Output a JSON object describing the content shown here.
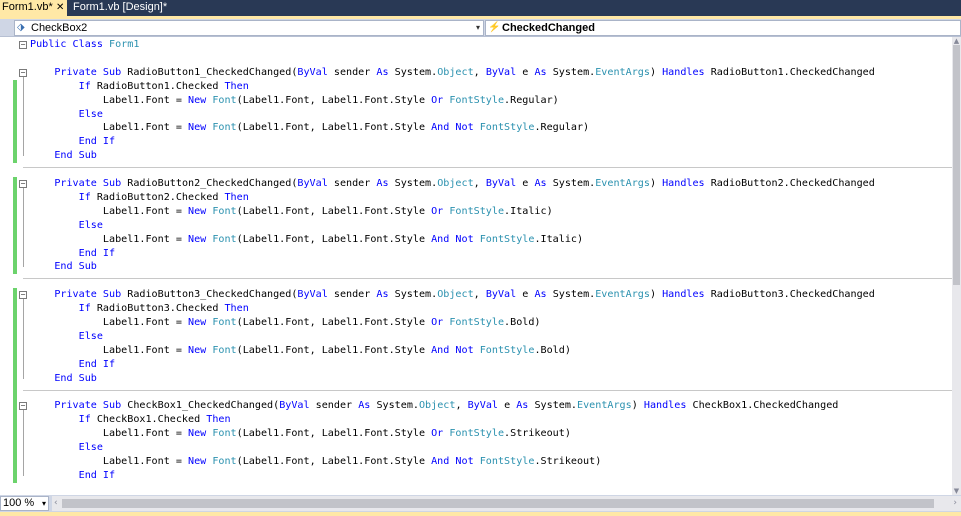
{
  "tabs": [
    {
      "label": "Form1.vb*",
      "close": "✕",
      "active": true
    },
    {
      "label": "Form1.vb [Design]*",
      "active": false
    }
  ],
  "navbar": {
    "object_combo": "CheckBox2",
    "event_combo": "CheckedChanged",
    "object_icon": "control-icon",
    "event_icon": "lightning-icon",
    "arrow": "▾"
  },
  "code_lines": [
    [
      [
        "kw",
        "Public Class "
      ],
      [
        "ty",
        "Form1"
      ]
    ],
    [],
    [
      [
        "",
        "    "
      ],
      [
        "kw",
        "Private Sub "
      ],
      [
        "",
        "RadioButton1_CheckedChanged("
      ],
      [
        "kw",
        "ByVal "
      ],
      [
        "",
        "sender "
      ],
      [
        "kw",
        "As "
      ],
      [
        "",
        "System."
      ],
      [
        "ty",
        "Object"
      ],
      [
        "",
        ", "
      ],
      [
        "kw",
        "ByVal "
      ],
      [
        "",
        "e "
      ],
      [
        "kw",
        "As "
      ],
      [
        "",
        "System."
      ],
      [
        "ty",
        "EventArgs"
      ],
      [
        "",
        ") "
      ],
      [
        "kw",
        "Handles "
      ],
      [
        "",
        "RadioButton1.CheckedChanged"
      ]
    ],
    [
      [
        "",
        "        "
      ],
      [
        "kw",
        "If "
      ],
      [
        "",
        "RadioButton1.Checked "
      ],
      [
        "kw",
        "Then"
      ]
    ],
    [
      [
        "",
        "            Label1.Font = "
      ],
      [
        "kw",
        "New "
      ],
      [
        "ty",
        "Font"
      ],
      [
        "",
        "(Label1.Font, Label1.Font.Style "
      ],
      [
        "kw",
        "Or "
      ],
      [
        "ty",
        "FontStyle"
      ],
      [
        "",
        ".Regular)"
      ]
    ],
    [
      [
        "",
        "        "
      ],
      [
        "kw",
        "Else"
      ]
    ],
    [
      [
        "",
        "            Label1.Font = "
      ],
      [
        "kw",
        "New "
      ],
      [
        "ty",
        "Font"
      ],
      [
        "",
        "(Label1.Font, Label1.Font.Style "
      ],
      [
        "kw",
        "And Not "
      ],
      [
        "ty",
        "FontStyle"
      ],
      [
        "",
        ".Regular)"
      ]
    ],
    [
      [
        "",
        "        "
      ],
      [
        "kw",
        "End If"
      ]
    ],
    [
      [
        "",
        "    "
      ],
      [
        "kw",
        "End Sub"
      ]
    ],
    [],
    [
      [
        "",
        "    "
      ],
      [
        "kw",
        "Private Sub "
      ],
      [
        "",
        "RadioButton2_CheckedChanged("
      ],
      [
        "kw",
        "ByVal "
      ],
      [
        "",
        "sender "
      ],
      [
        "kw",
        "As "
      ],
      [
        "",
        "System."
      ],
      [
        "ty",
        "Object"
      ],
      [
        "",
        ", "
      ],
      [
        "kw",
        "ByVal "
      ],
      [
        "",
        "e "
      ],
      [
        "kw",
        "As "
      ],
      [
        "",
        "System."
      ],
      [
        "ty",
        "EventArgs"
      ],
      [
        "",
        ") "
      ],
      [
        "kw",
        "Handles "
      ],
      [
        "",
        "RadioButton2.CheckedChanged"
      ]
    ],
    [
      [
        "",
        "        "
      ],
      [
        "kw",
        "If "
      ],
      [
        "",
        "RadioButton2.Checked "
      ],
      [
        "kw",
        "Then"
      ]
    ],
    [
      [
        "",
        "            Label1.Font = "
      ],
      [
        "kw",
        "New "
      ],
      [
        "ty",
        "Font"
      ],
      [
        "",
        "(Label1.Font, Label1.Font.Style "
      ],
      [
        "kw",
        "Or "
      ],
      [
        "ty",
        "FontStyle"
      ],
      [
        "",
        ".Italic)"
      ]
    ],
    [
      [
        "",
        "        "
      ],
      [
        "kw",
        "Else"
      ]
    ],
    [
      [
        "",
        "            Label1.Font = "
      ],
      [
        "kw",
        "New "
      ],
      [
        "ty",
        "Font"
      ],
      [
        "",
        "(Label1.Font, Label1.Font.Style "
      ],
      [
        "kw",
        "And Not "
      ],
      [
        "ty",
        "FontStyle"
      ],
      [
        "",
        ".Italic)"
      ]
    ],
    [
      [
        "",
        "        "
      ],
      [
        "kw",
        "End If"
      ]
    ],
    [
      [
        "",
        "    "
      ],
      [
        "kw",
        "End Sub"
      ]
    ],
    [],
    [
      [
        "",
        "    "
      ],
      [
        "kw",
        "Private Sub "
      ],
      [
        "",
        "RadioButton3_CheckedChanged("
      ],
      [
        "kw",
        "ByVal "
      ],
      [
        "",
        "sender "
      ],
      [
        "kw",
        "As "
      ],
      [
        "",
        "System."
      ],
      [
        "ty",
        "Object"
      ],
      [
        "",
        ", "
      ],
      [
        "kw",
        "ByVal "
      ],
      [
        "",
        "e "
      ],
      [
        "kw",
        "As "
      ],
      [
        "",
        "System."
      ],
      [
        "ty",
        "EventArgs"
      ],
      [
        "",
        ") "
      ],
      [
        "kw",
        "Handles "
      ],
      [
        "",
        "RadioButton3.CheckedChanged"
      ]
    ],
    [
      [
        "",
        "        "
      ],
      [
        "kw",
        "If "
      ],
      [
        "",
        "RadioButton3.Checked "
      ],
      [
        "kw",
        "Then"
      ]
    ],
    [
      [
        "",
        "            Label1.Font = "
      ],
      [
        "kw",
        "New "
      ],
      [
        "ty",
        "Font"
      ],
      [
        "",
        "(Label1.Font, Label1.Font.Style "
      ],
      [
        "kw",
        "Or "
      ],
      [
        "ty",
        "FontStyle"
      ],
      [
        "",
        ".Bold)"
      ]
    ],
    [
      [
        "",
        "        "
      ],
      [
        "kw",
        "Else"
      ]
    ],
    [
      [
        "",
        "            Label1.Font = "
      ],
      [
        "kw",
        "New "
      ],
      [
        "ty",
        "Font"
      ],
      [
        "",
        "(Label1.Font, Label1.Font.Style "
      ],
      [
        "kw",
        "And Not "
      ],
      [
        "ty",
        "FontStyle"
      ],
      [
        "",
        ".Bold)"
      ]
    ],
    [
      [
        "",
        "        "
      ],
      [
        "kw",
        "End If"
      ]
    ],
    [
      [
        "",
        "    "
      ],
      [
        "kw",
        "End Sub"
      ]
    ],
    [],
    [
      [
        "",
        "    "
      ],
      [
        "kw",
        "Private Sub "
      ],
      [
        "",
        "CheckBox1_CheckedChanged("
      ],
      [
        "kw",
        "ByVal "
      ],
      [
        "",
        "sender "
      ],
      [
        "kw",
        "As "
      ],
      [
        "",
        "System."
      ],
      [
        "ty",
        "Object"
      ],
      [
        "",
        ", "
      ],
      [
        "kw",
        "ByVal "
      ],
      [
        "",
        "e "
      ],
      [
        "kw",
        "As "
      ],
      [
        "",
        "System."
      ],
      [
        "ty",
        "EventArgs"
      ],
      [
        "",
        ") "
      ],
      [
        "kw",
        "Handles "
      ],
      [
        "",
        "CheckBox1.CheckedChanged"
      ]
    ],
    [
      [
        "",
        "        "
      ],
      [
        "kw",
        "If "
      ],
      [
        "",
        "CheckBox1.Checked "
      ],
      [
        "kw",
        "Then"
      ]
    ],
    [
      [
        "",
        "            Label1.Font = "
      ],
      [
        "kw",
        "New "
      ],
      [
        "ty",
        "Font"
      ],
      [
        "",
        "(Label1.Font, Label1.Font.Style "
      ],
      [
        "kw",
        "Or "
      ],
      [
        "ty",
        "FontStyle"
      ],
      [
        "",
        ".Strikeout)"
      ]
    ],
    [
      [
        "",
        "        "
      ],
      [
        "kw",
        "Else"
      ]
    ],
    [
      [
        "",
        "            Label1.Font = "
      ],
      [
        "kw",
        "New "
      ],
      [
        "ty",
        "Font"
      ],
      [
        "",
        "(Label1.Font, Label1.Font.Style "
      ],
      [
        "kw",
        "And Not "
      ],
      [
        "ty",
        "FontStyle"
      ],
      [
        "",
        ".Strikeout)"
      ]
    ],
    [
      [
        "",
        "        "
      ],
      [
        "kw",
        "End If"
      ]
    ]
  ],
  "fold_rows": [
    0,
    2,
    10,
    18,
    26
  ],
  "separator_rows": [
    9,
    17,
    25
  ],
  "changed_rows": [
    [
      3,
      8
    ],
    [
      10,
      16
    ],
    [
      18,
      25
    ],
    [
      26,
      31
    ]
  ],
  "fold_glyph": "−",
  "colors": {
    "keyword": "#0000ff",
    "type": "#2b91af",
    "tab_active": "#ffe8a6",
    "tabstrip": "#293955",
    "change_marker": "#6cd36c"
  },
  "zoom": "100 %",
  "zoom_arrow": "▾",
  "scroll_left": "‹",
  "scroll_right": "›",
  "scroll_up": "▲",
  "scroll_down": "▼"
}
